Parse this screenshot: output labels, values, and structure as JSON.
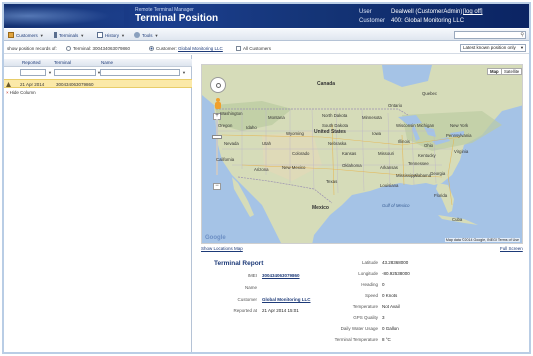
{
  "header": {
    "subtitle": "Remote Terminal Manager",
    "title": "Terminal Position",
    "user_label": "User",
    "user_value": "Dealwell (CustomerAdmin)",
    "logoff": "[log off]",
    "customer_label": "Customer",
    "customer_value": "400: Global Monitoring LLC"
  },
  "toolbar": {
    "items": [
      {
        "label": "Customers"
      },
      {
        "label": "Terminals"
      },
      {
        "label": "History"
      },
      {
        "label": "Tools"
      }
    ],
    "search_value": ""
  },
  "filter": {
    "prefix": "show position records of:",
    "radio_terminal": "Terminal: 300434063079860",
    "radio_customer_prefix": "Customer:",
    "radio_customer_link": "Global Monitoring LLC",
    "radio_all": "All Customers",
    "select_value": "Latest known position only"
  },
  "grid": {
    "columns": [
      "Reported",
      "Terminal",
      "Name"
    ],
    "rows": [
      {
        "reported": "21 Apr 2014",
        "terminal": "300434063079860",
        "name": ""
      }
    ],
    "hide_column_text": "Hide Column"
  },
  "map": {
    "type_map": "Map",
    "type_satellite": "Satellite",
    "labels": {
      "canada": "Canada",
      "united_states": "United States",
      "mexico": "Mexico",
      "gulf": "Gulf of Mexico",
      "cuba": "Cuba",
      "north_dakota": "North Dakota",
      "south_dakota": "South Dakota",
      "montana": "Montana",
      "wyoming": "Wyoming",
      "nebraska": "Nebraska",
      "colorado": "Colorado",
      "kansas": "Kansas",
      "oklahoma": "Oklahoma",
      "texas": "Texas",
      "new_mexico": "New Mexico",
      "arizona": "Arizona",
      "utah": "Utah",
      "nevada": "Nevada",
      "california": "California",
      "oregon": "Oregon",
      "idaho": "Idaho",
      "washington": "Washington",
      "minnesota": "Minnesota",
      "iowa": "Iowa",
      "missouri": "Missouri",
      "illinois": "Illinois",
      "wisconsin": "Wisconsin",
      "michigan": "Michigan",
      "ohio": "Ohio",
      "kentucky": "Kentucky",
      "tennessee": "Tennessee",
      "georgia": "Georgia",
      "alabama": "Alabama",
      "mississippi": "Mississippi",
      "arkansas": "Arkansas",
      "louisiana": "Louisiana",
      "florida": "Florida",
      "virginia": "Virginia",
      "pennsylvania": "Pennsylvania",
      "new_york": "New York",
      "quebec": "Quebec",
      "ontario": "Ontario"
    },
    "google": "Google",
    "attribution": "Map data ©2014 Google, INEGI   Terms of Use",
    "below_left": "Show Locations Map",
    "below_right": "Full Screen"
  },
  "report": {
    "title": "Terminal Report",
    "left": [
      {
        "key": "IMEI",
        "value": "300434063079860",
        "link": true
      },
      {
        "key": "Name",
        "value": "",
        "link": false
      },
      {
        "key": "Customer",
        "value": "Global Monitoring LLC",
        "link": true
      },
      {
        "key": "Reported at",
        "value": "21 Apr 2014 15:01",
        "link": false
      }
    ],
    "right": [
      {
        "key": "Latitude",
        "value": "43.28368000"
      },
      {
        "key": "Longitude",
        "value": "-80.92538000"
      },
      {
        "key": "Heading",
        "value": "0"
      },
      {
        "key": "Speed",
        "value": "0 Knots"
      },
      {
        "key": "Temperature",
        "value": "Not Avail"
      },
      {
        "key": "GPS Quality",
        "value": "3"
      },
      {
        "key": "Daily Water Usage",
        "value": "0 Gallon"
      },
      {
        "key": "Terminal Temperature",
        "value": "8 °C"
      },
      {
        "key": "",
        "value": ""
      }
    ]
  }
}
